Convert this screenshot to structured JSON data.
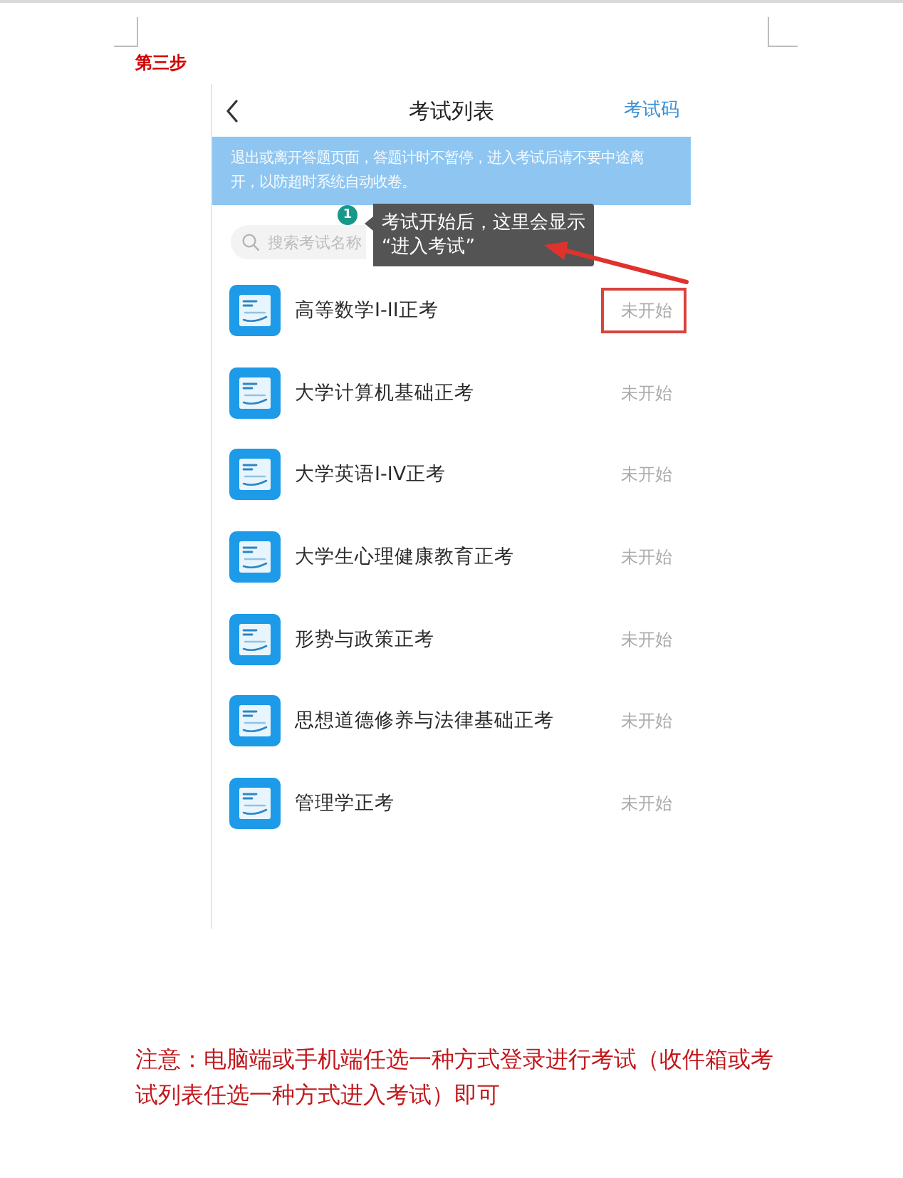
{
  "step_title": "第三步",
  "phone": {
    "header": {
      "title": "考试列表",
      "action": "考试码"
    },
    "notice": "退出或离开答题页面，答题计时不暂停，进入考试后请不要中途离开，以防超时系统自动收卷。",
    "search": {
      "placeholder": "搜索考试名称"
    },
    "tooltip": {
      "badge": "1",
      "lines": [
        "考试开始后，这里会显示",
        "“进入考试”"
      ]
    },
    "exams": [
      {
        "title": "高等数学I-II正考",
        "status": "未开始",
        "highlighted": true
      },
      {
        "title": "大学计算机基础正考",
        "status": "未开始",
        "highlighted": false
      },
      {
        "title": "大学英语I-IV正考",
        "status": "未开始",
        "highlighted": false
      },
      {
        "title": "大学生心理健康教育正考",
        "status": "未开始",
        "highlighted": false
      },
      {
        "title": "形势与政策正考",
        "status": "未开始",
        "highlighted": false
      },
      {
        "title": "思想道德修养与法律基础正考",
        "status": "未开始",
        "highlighted": false
      },
      {
        "title": "管理学正考",
        "status": "未开始",
        "highlighted": false
      }
    ]
  },
  "note": "注意：电脑端或手机端任选一种方式登录进行考试（收件箱或考试列表任选一种方式进入考试）即可"
}
